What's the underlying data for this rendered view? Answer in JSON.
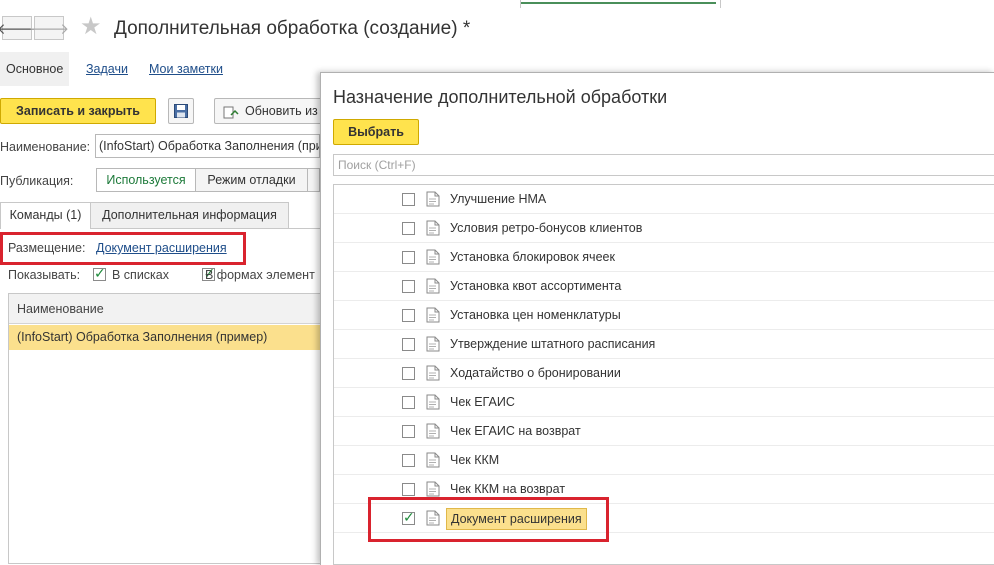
{
  "window": {
    "title": "Дополнительная обработка (создание) *"
  },
  "section_tabs": [
    {
      "label": "Основное"
    },
    {
      "label": "Задачи"
    },
    {
      "label": "Мои заметки"
    }
  ],
  "toolbar": {
    "save_close_label": "Записать и закрыть",
    "refresh_label": "Обновить из"
  },
  "form": {
    "name_label": "Наименование:",
    "name_value": "(InfoStart) Обработка Заполнения (пример)",
    "publication_label": "Публикация:",
    "publication_options": [
      "Используется",
      "Режим отладки"
    ],
    "page_tabs": [
      "Команды (1)",
      "Дополнительная информация"
    ],
    "placement_label": "Размещение:",
    "placement_value": "Документ расширения",
    "show_label": "Показывать:",
    "show_in_lists": "В списках",
    "show_in_forms": "В формах элемент"
  },
  "grid": {
    "header": "Наименование",
    "rows": [
      "(InfoStart) Обработка Заполнения (пример)"
    ]
  },
  "dialog": {
    "title": "Назначение дополнительной обработки",
    "choose_label": "Выбрать",
    "search_placeholder": "Поиск (Ctrl+F)",
    "items": [
      {
        "label": "Улучшение НМА",
        "checked": false
      },
      {
        "label": "Условия ретро-бонусов клиентов",
        "checked": false
      },
      {
        "label": "Установка блокировок ячеек",
        "checked": false
      },
      {
        "label": "Установка квот ассортимента",
        "checked": false
      },
      {
        "label": "Установка цен номенклатуры",
        "checked": false
      },
      {
        "label": "Утверждение штатного расписания",
        "checked": false
      },
      {
        "label": "Ходатайство о бронировании",
        "checked": false
      },
      {
        "label": "Чек ЕГАИС",
        "checked": false
      },
      {
        "label": "Чек ЕГАИС на возврат",
        "checked": false
      },
      {
        "label": "Чек ККМ",
        "checked": false
      },
      {
        "label": "Чек ККМ на возврат",
        "checked": false
      },
      {
        "label": "Документ расширения",
        "checked": true
      }
    ]
  },
  "colors": {
    "accent_yellow": "#ffe34d",
    "selection": "#fbe08d",
    "highlight_red": "#d9232e",
    "link_blue": "#1f4e8a",
    "check_green": "#1d8a3a"
  }
}
